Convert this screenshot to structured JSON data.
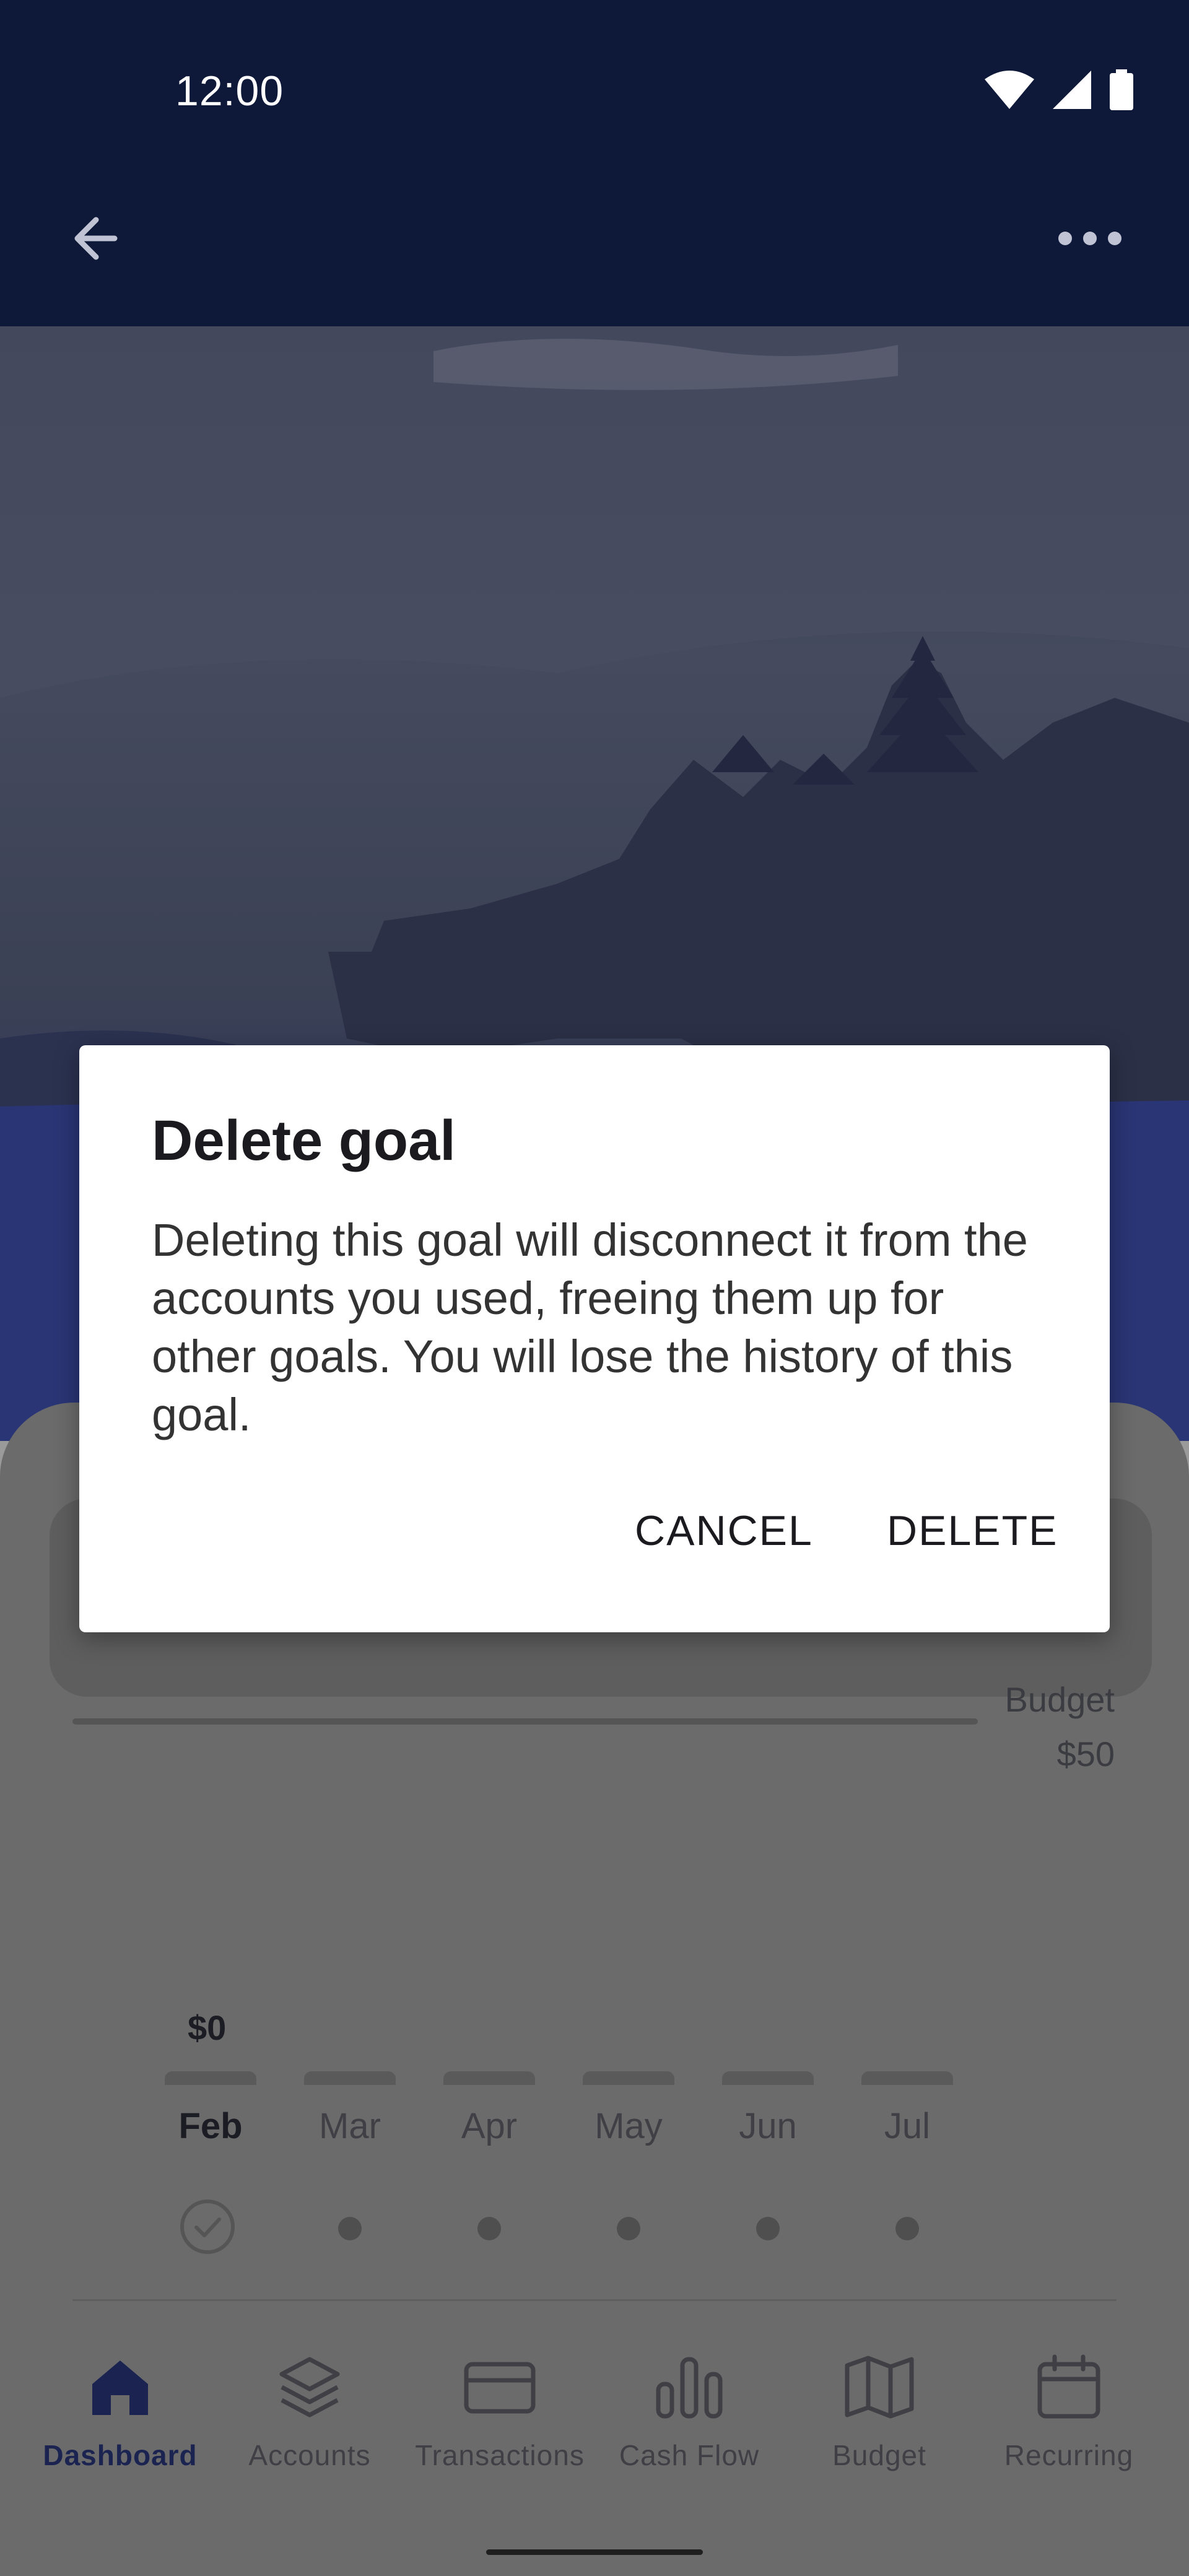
{
  "status_bar": {
    "time": "12:00",
    "icons": [
      "wifi-icon",
      "signal-icon",
      "battery-icon"
    ]
  },
  "app_bar": {
    "back_icon": "arrow-left-icon",
    "more_icon": "more-horizontal-icon"
  },
  "goal_detail": {
    "budget_label": "Budget",
    "budget_value": "$50",
    "current_amount": "$0",
    "months": [
      {
        "label": "Feb",
        "active": true,
        "state": "complete"
      },
      {
        "label": "Mar",
        "active": false,
        "state": "upcoming"
      },
      {
        "label": "Apr",
        "active": false,
        "state": "upcoming"
      },
      {
        "label": "May",
        "active": false,
        "state": "upcoming"
      },
      {
        "label": "Jun",
        "active": false,
        "state": "upcoming"
      },
      {
        "label": "Jul",
        "active": false,
        "state": "upcoming"
      }
    ]
  },
  "bottom_nav": {
    "items": [
      {
        "label": "Dashboard",
        "icon": "home-icon",
        "active": true
      },
      {
        "label": "Accounts",
        "icon": "layers-icon",
        "active": false
      },
      {
        "label": "Transactions",
        "icon": "credit-card-icon",
        "active": false
      },
      {
        "label": "Cash Flow",
        "icon": "bar-chart-icon",
        "active": false
      },
      {
        "label": "Budget",
        "icon": "map-icon",
        "active": false
      },
      {
        "label": "Recurring",
        "icon": "calendar-icon",
        "active": false
      }
    ]
  },
  "dialog": {
    "title": "Delete goal",
    "body": "Deleting this goal will disconnect it from the accounts you used, freeing them up for other goals. You will lose the history of this goal.",
    "cancel_label": "CANCEL",
    "delete_label": "DELETE"
  },
  "colors": {
    "app_bar": "#0e1838",
    "sheet": "#6b6b6b",
    "dialog_bg": "#ffffff",
    "active_nav": "#1b2450"
  }
}
